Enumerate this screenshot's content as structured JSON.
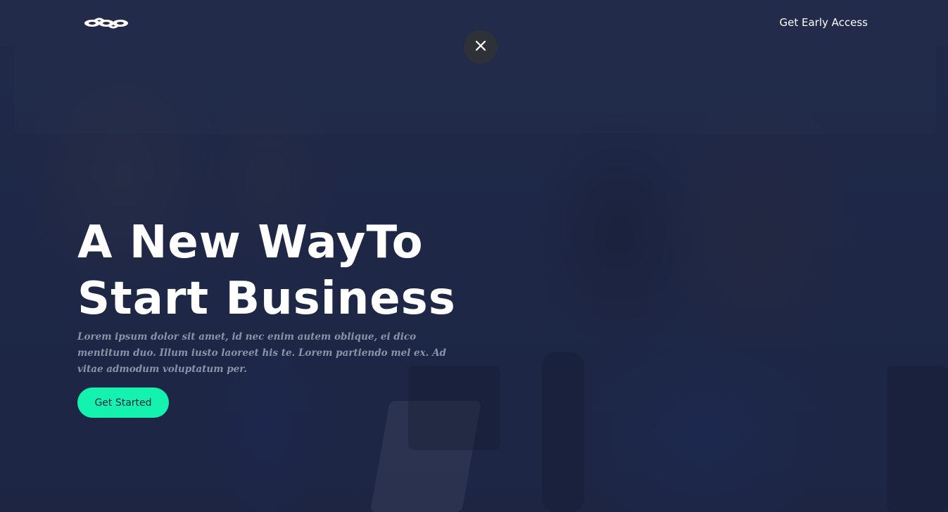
{
  "header": {
    "logo_icon": "chain-link-logo-icon",
    "early_access_label": "Get Early Access"
  },
  "modal": {
    "close_icon": "close-icon"
  },
  "hero": {
    "headline_line1": "A New WayTo",
    "headline_line2": "Start Business",
    "description": "Lorem ipsum dolor sit amet, id nec enim autem oblique, ei dico mentitum duo. Illum iusto laoreet his te. Lorem partiendo mel ex. Ad vitae admodum voluptatum per.",
    "cta_label": "Get Started"
  },
  "colors": {
    "background": "#222b4a",
    "accent": "#14f2b0",
    "text": "#ffffff",
    "muted_text": "#8c93a8"
  }
}
